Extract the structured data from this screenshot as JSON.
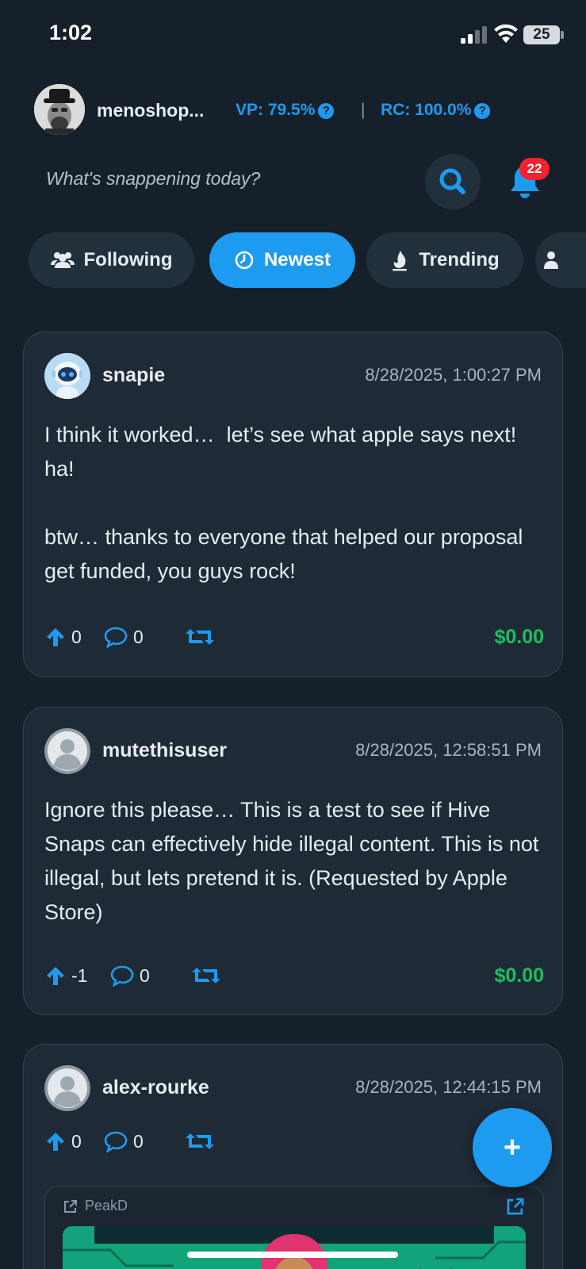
{
  "status_bar": {
    "time": "1:02",
    "battery": "25"
  },
  "header": {
    "username": "menoshop...",
    "vp_label": "VP: 79.5%",
    "separator": "|",
    "rc_label": "RC: 100.0%",
    "info_glyph": "?"
  },
  "compose": {
    "prompt": "What's snappening today?"
  },
  "notifications": {
    "count": "22"
  },
  "filters": [
    {
      "label": "Following",
      "icon": "users-icon",
      "active": false
    },
    {
      "label": "Newest",
      "icon": "clock-icon",
      "active": true
    },
    {
      "label": "Trending",
      "icon": "fire-icon",
      "active": false
    }
  ],
  "posts": [
    {
      "author": "snapie",
      "timestamp": "8/28/2025, 1:00:27 PM",
      "body": "I think it worked…  let’s see what apple says next! ha!\n\nbtw… thanks to everyone that helped our proposal get funded, you guys rock!",
      "votes": "0",
      "comments": "0",
      "payout": "$0.00"
    },
    {
      "author": "mutethisuser",
      "timestamp": "8/28/2025, 12:58:51 PM",
      "body": "Ignore this please… This is a test to see if Hive Snaps can effectively hide illegal content. This is not illegal, but lets pretend it is. (Requested by Apple Store)",
      "votes": "-1",
      "comments": "0",
      "payout": "$0.00"
    },
    {
      "author": "alex-rourke",
      "timestamp": "8/28/2025, 12:44:15 PM",
      "votes": "0",
      "comments": "0",
      "embed_source": "PeakD"
    }
  ],
  "fab": {
    "label": "+"
  },
  "colors": {
    "accent": "#1d9bf0",
    "background": "#15202b",
    "card": "#1e2a36",
    "payout": "#17bf63",
    "badge": "#f4212e"
  }
}
